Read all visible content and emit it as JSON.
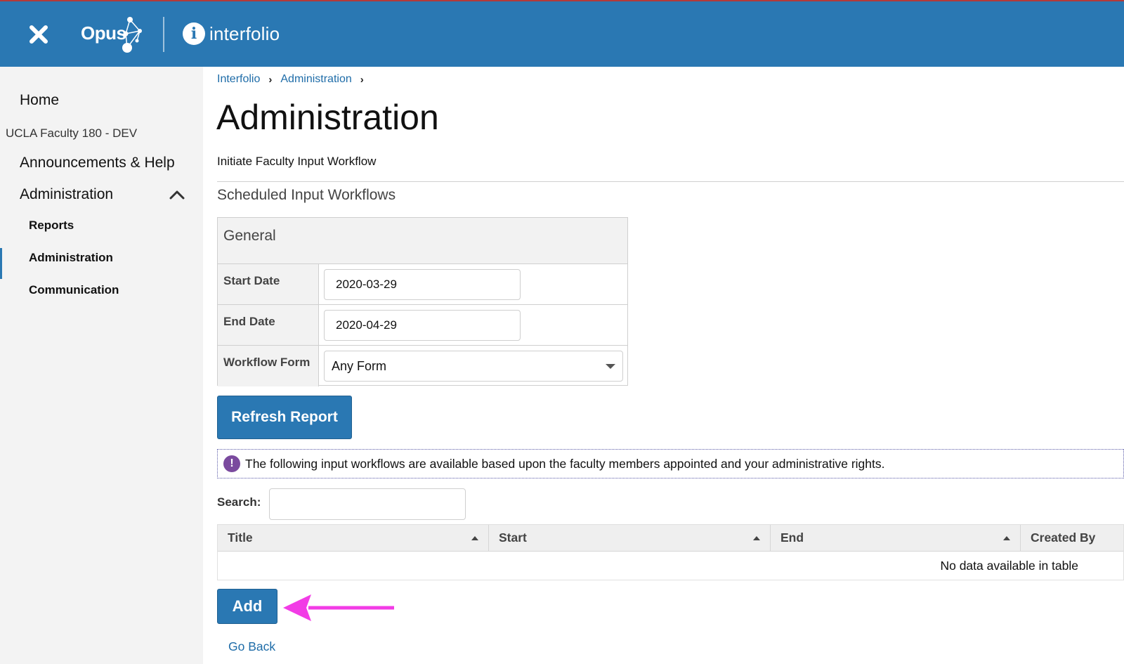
{
  "header": {
    "close_label": "close",
    "opus_brand": "Opus",
    "interfolio_brand": "interfolio",
    "bar_color": "#2a78b3"
  },
  "sidebar": {
    "home": "Home",
    "org_name": "UCLA Faculty 180 - DEV",
    "announcements": "Announcements & Help",
    "administration": "Administration",
    "sub_items": [
      "Reports",
      "Administration",
      "Communication"
    ],
    "active_item": "Administration"
  },
  "breadcrumb": [
    "Interfolio",
    "Administration"
  ],
  "page": {
    "title": "Administration",
    "initiate_link": "Initiate Faculty Input Workflow",
    "section_title": "Scheduled Input Workflows"
  },
  "filters": {
    "panel_title": "General",
    "start_date_label": "Start Date",
    "start_date_value": "2020-03-29",
    "end_date_label": "End Date",
    "end_date_value": "2020-04-29",
    "workflow_form_label": "Workflow Form",
    "workflow_form_value": "Any Form"
  },
  "refresh_button": "Refresh Report",
  "notice": {
    "icon": "!",
    "text": "The following input workflows are available based upon the faculty members appointed and your administrative rights."
  },
  "search": {
    "label": "Search:",
    "value": ""
  },
  "table": {
    "columns": [
      "Title",
      "Start",
      "End",
      "Created By"
    ],
    "empty_message": "No data available in table"
  },
  "add_button": "Add",
  "go_back": "Go Back",
  "annotation": {
    "arrow_color": "#f23ce6"
  }
}
